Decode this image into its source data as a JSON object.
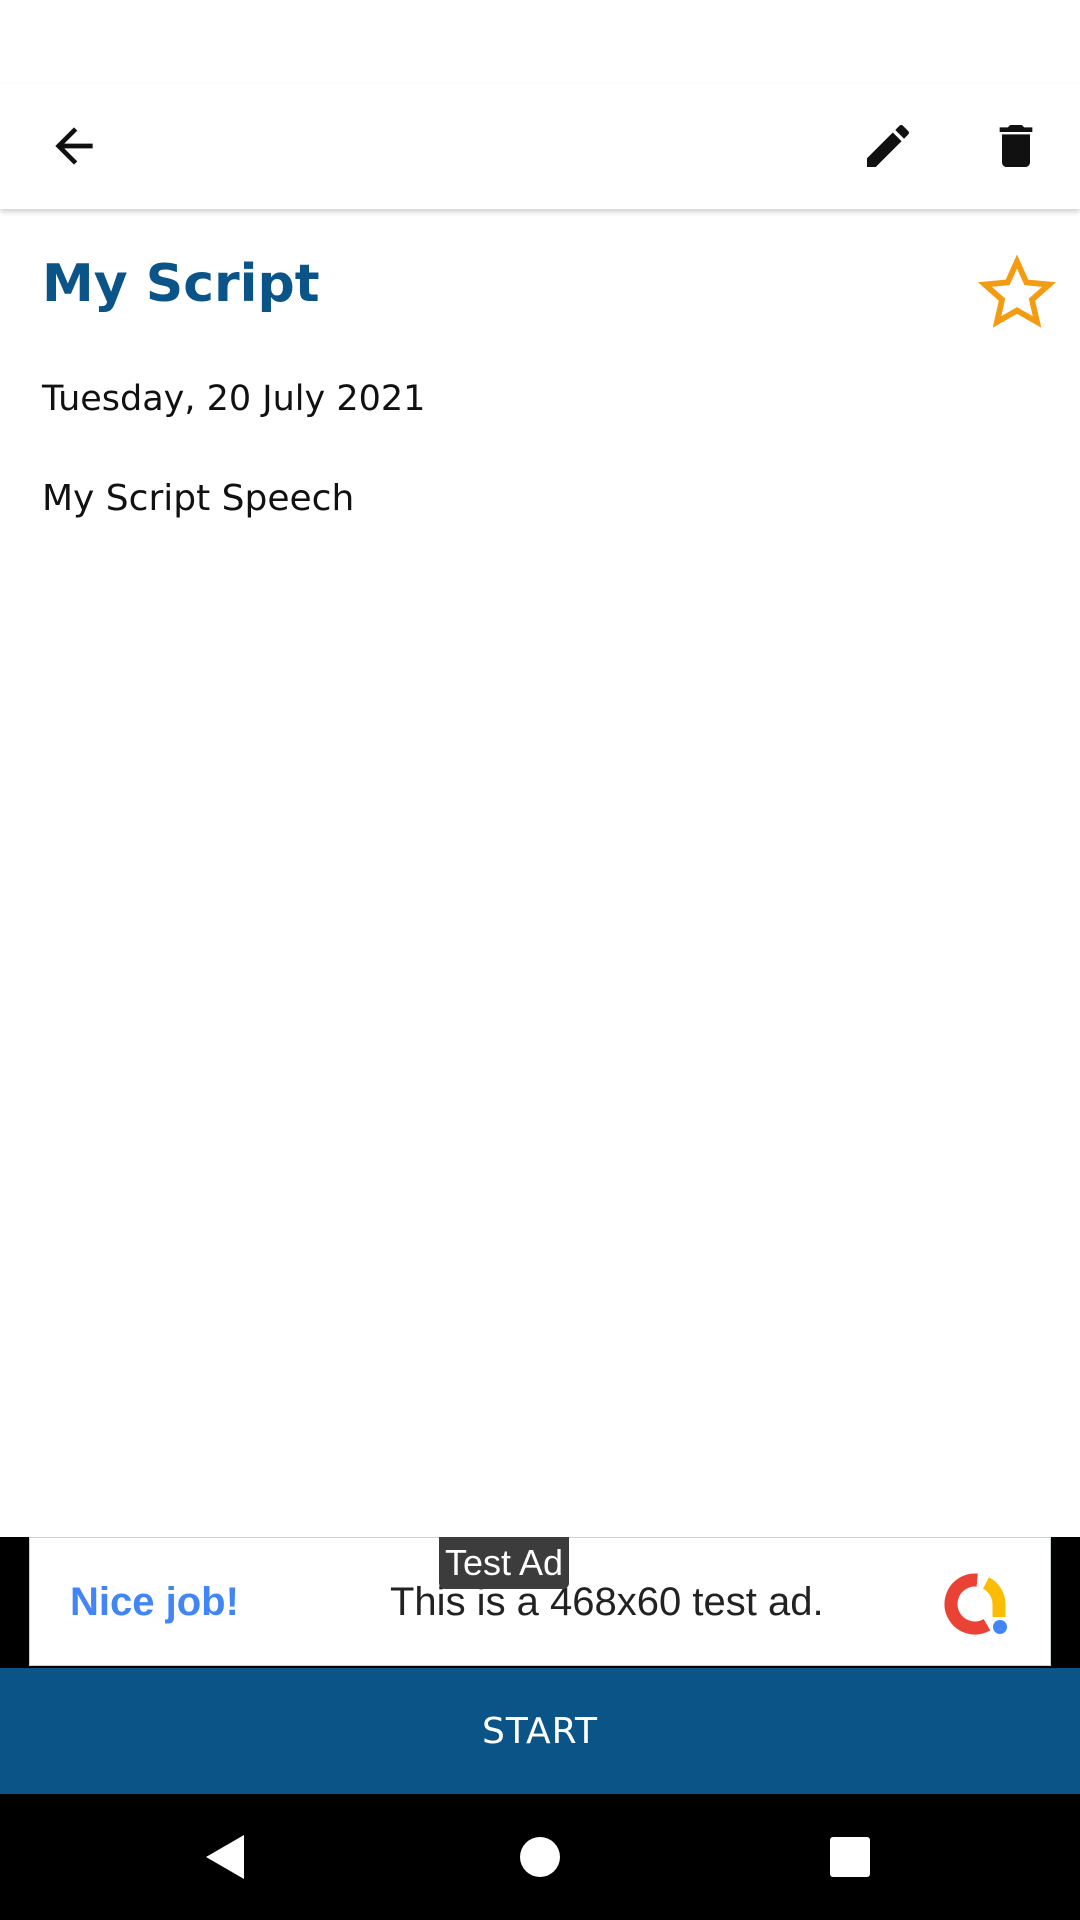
{
  "toolbar": {
    "back_icon": "arrow-back-icon",
    "edit_icon": "pencil-icon",
    "delete_icon": "trash-icon"
  },
  "script": {
    "title": "My Script",
    "date": "Tuesday, 20 July 2021",
    "speech": "My Script Speech",
    "favorite_icon": "star-outline-icon"
  },
  "ad": {
    "tag": "Test Ad",
    "headline": "Nice job!",
    "body": "This is a 468x60 test ad."
  },
  "actions": {
    "start_label": "START"
  },
  "colors": {
    "primary": "#0a5488",
    "star": "#f39c12",
    "ad_headline": "#4285f4"
  }
}
